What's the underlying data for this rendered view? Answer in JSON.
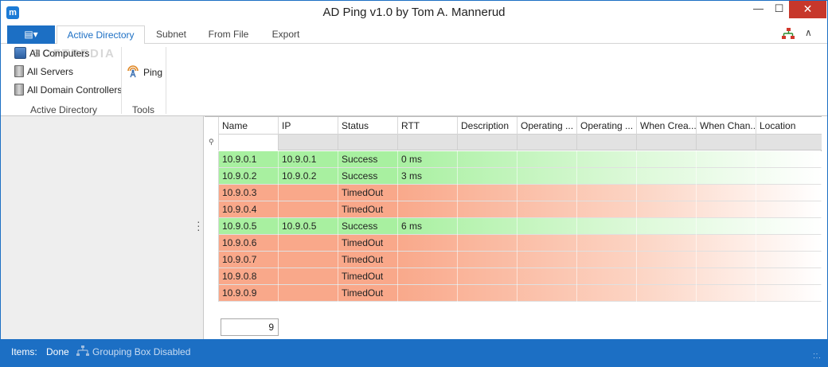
{
  "window": {
    "title": "AD Ping v1.0 by Tom A. Mannerud",
    "app_icon_letter": "m",
    "minimize_glyph": "—",
    "maximize_glyph": "☐",
    "close_glyph": "✕"
  },
  "ribbon": {
    "file_menu_glyph": "▤▾",
    "tabs": [
      {
        "label": "Active Directory",
        "active": true
      },
      {
        "label": "Subnet",
        "active": false
      },
      {
        "label": "From File",
        "active": false
      },
      {
        "label": "Export",
        "active": false
      }
    ],
    "collapse_glyph": "∧",
    "watermark": "SOFTPEDIA",
    "groups": [
      {
        "label": "Active Directory",
        "buttons": [
          {
            "label": "All Computers",
            "icon": "computer-icon"
          },
          {
            "label": "All Servers",
            "icon": "server-icon"
          },
          {
            "label": "All Domain Controllers",
            "icon": "domain-controller-icon"
          }
        ]
      },
      {
        "label": "Tools",
        "buttons": [
          {
            "label": "Ping",
            "icon": "ping-icon"
          }
        ]
      }
    ]
  },
  "grid": {
    "pin_glyph": "⚲",
    "columns": [
      "Name",
      "IP",
      "Status",
      "RTT",
      "Description",
      "Operating ...",
      "Operating ...",
      "When Crea...",
      "When Chan...",
      "Location"
    ],
    "rows": [
      {
        "name": "10.9.0.1",
        "ip": "10.9.0.1",
        "status": "Success",
        "rtt": "0 ms"
      },
      {
        "name": "10.9.0.2",
        "ip": "10.9.0.2",
        "status": "Success",
        "rtt": "3 ms"
      },
      {
        "name": "10.9.0.3",
        "ip": "",
        "status": "TimedOut",
        "rtt": ""
      },
      {
        "name": "10.9.0.4",
        "ip": "",
        "status": "TimedOut",
        "rtt": ""
      },
      {
        "name": "10.9.0.5",
        "ip": "10.9.0.5",
        "status": "Success",
        "rtt": "6 ms"
      },
      {
        "name": "10.9.0.6",
        "ip": "",
        "status": "TimedOut",
        "rtt": ""
      },
      {
        "name": "10.9.0.7",
        "ip": "",
        "status": "TimedOut",
        "rtt": ""
      },
      {
        "name": "10.9.0.8",
        "ip": "",
        "status": "TimedOut",
        "rtt": ""
      },
      {
        "name": "10.9.0.9",
        "ip": "",
        "status": "TimedOut",
        "rtt": ""
      }
    ],
    "count": "9",
    "colors": {
      "success": "#a8f0a0",
      "timedout": "#f9a88a"
    }
  },
  "statusbar": {
    "items_label": "Items:",
    "items_value": "Done",
    "grouping_label": "Grouping Box Disabled"
  },
  "colors": {
    "accent": "#1c6fc4",
    "close": "#c7372b"
  }
}
